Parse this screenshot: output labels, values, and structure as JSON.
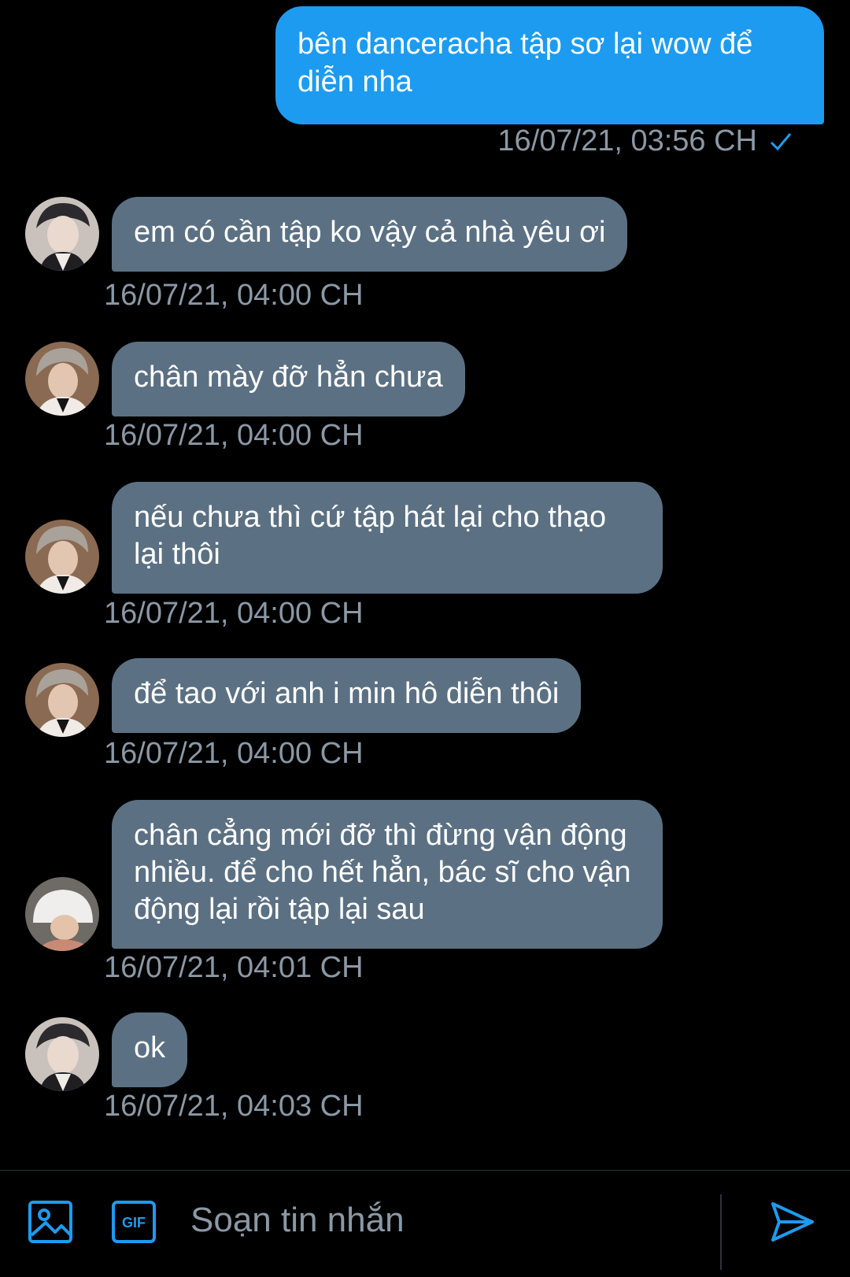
{
  "conversation": {
    "outgoing": {
      "text": "bên danceracha tập sơ lại wow để diễn nha",
      "time": "16/07/21, 03:56 CH"
    },
    "incoming": [
      {
        "text": "em có cần tập ko vậy cả nhà yêu ơi",
        "time": "16/07/21, 04:00 CH"
      },
      {
        "text": "chân mày đỡ hẳn chưa",
        "time": "16/07/21, 04:00 CH"
      },
      {
        "text": "nếu chưa thì cứ tập hát lại cho thạo lại thôi",
        "time": "16/07/21, 04:00 CH"
      },
      {
        "text": "để tao với anh i min hô diễn thôi",
        "time": "16/07/21, 04:00 CH"
      },
      {
        "text": "chân cẳng mới đỡ thì đừng vận động nhiều. để cho hết hẳn, bác sĩ cho vận động lại rồi tập lại sau",
        "time": "16/07/21, 04:01 CH"
      },
      {
        "text": "ok",
        "time": "16/07/21, 04:03 CH"
      }
    ]
  },
  "composer": {
    "placeholder": "Soạn tin nhắn",
    "gif_label": "GIF",
    "icons": [
      "image-icon",
      "gif-icon",
      "send-icon"
    ]
  },
  "colors": {
    "background": "#000000",
    "outgoing_bubble": "#1d9bf0",
    "incoming_bubble": "#5b7083",
    "meta_text": "#8b98a5",
    "accent": "#1d9bf0"
  }
}
